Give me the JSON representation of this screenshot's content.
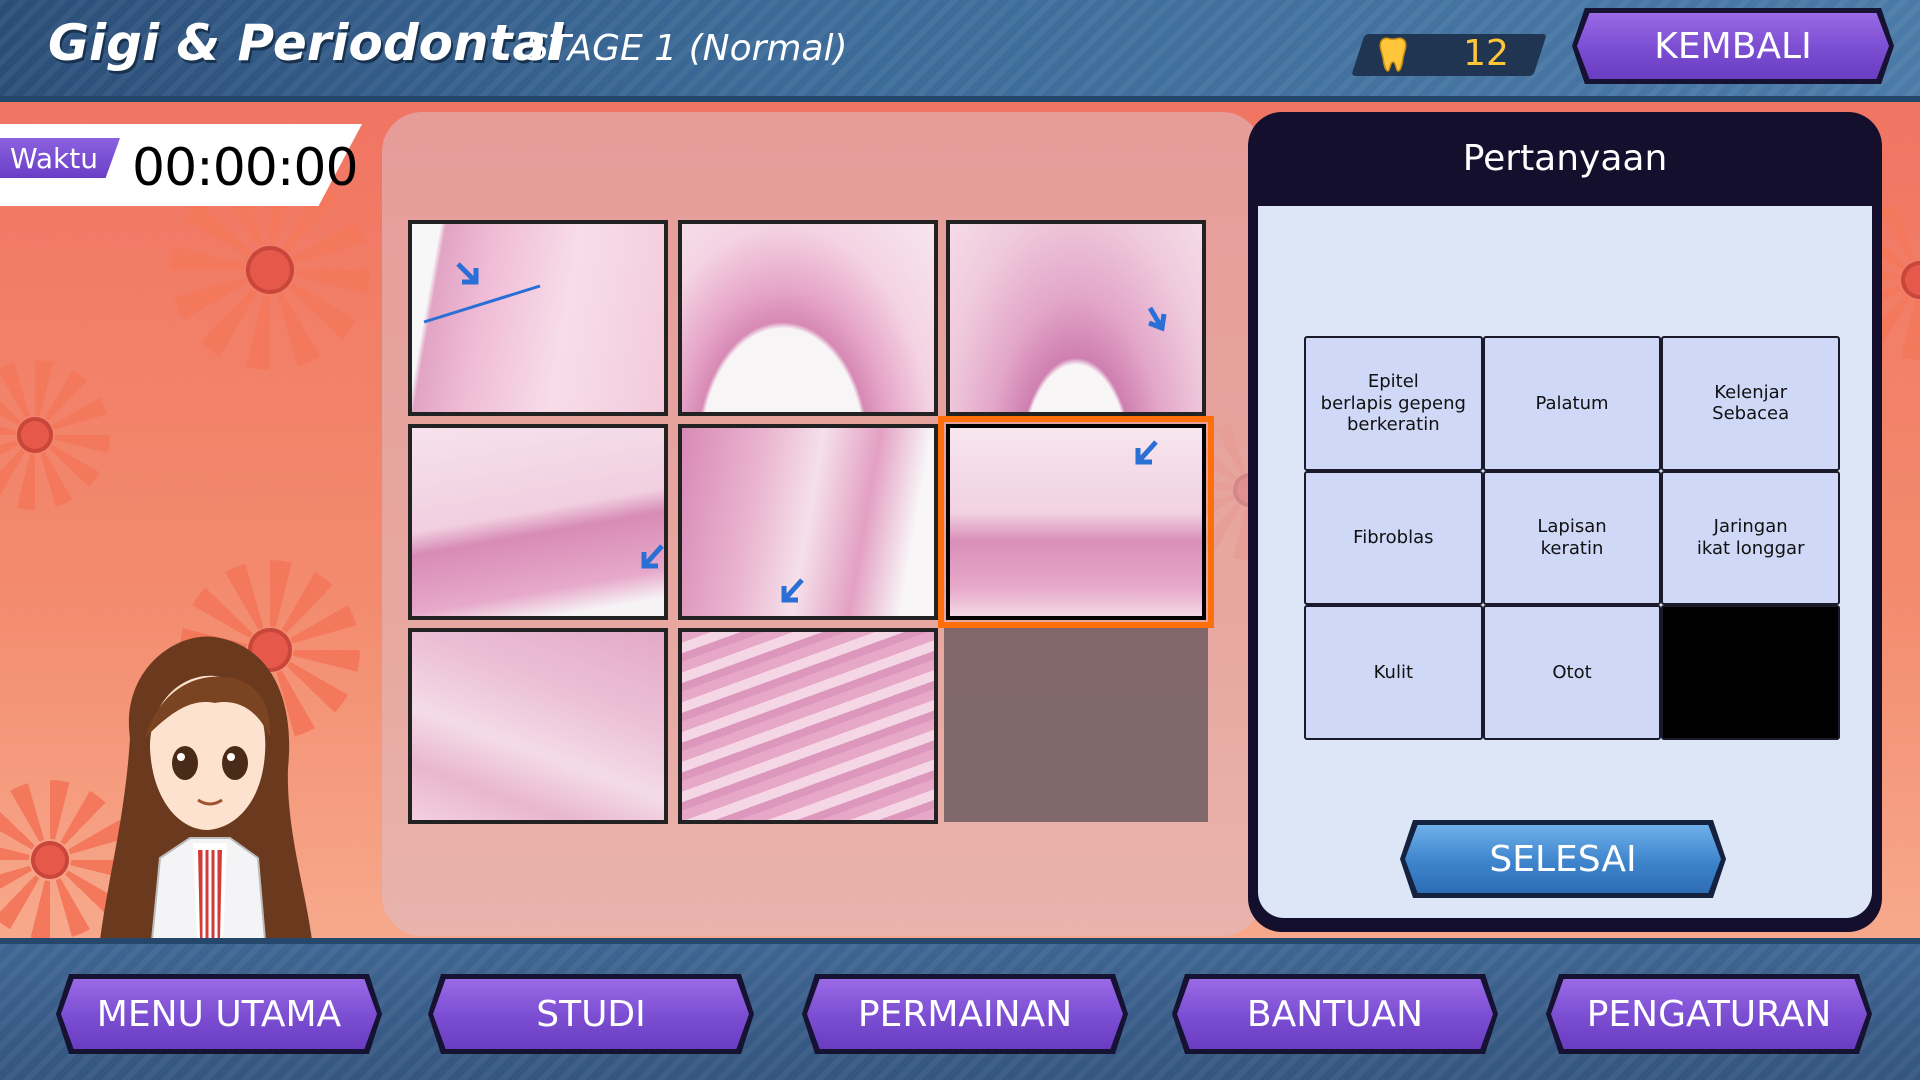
{
  "header": {
    "title": "Gigi & Periodontal",
    "stage": "STAGE 1 (Normal)",
    "score": "12",
    "back_label": "KEMBALI"
  },
  "timer": {
    "label": "Waktu",
    "value": "00:00:00"
  },
  "puzzle": {
    "tiles": [
      {
        "id": 1,
        "state": "filled"
      },
      {
        "id": 2,
        "state": "filled"
      },
      {
        "id": 3,
        "state": "filled"
      },
      {
        "id": 4,
        "state": "filled"
      },
      {
        "id": 5,
        "state": "filled"
      },
      {
        "id": 6,
        "state": "selected"
      },
      {
        "id": 7,
        "state": "filled"
      },
      {
        "id": 8,
        "state": "filled"
      },
      {
        "id": 9,
        "state": "empty"
      }
    ]
  },
  "question_panel": {
    "title": "Pertanyaan",
    "answers": [
      "Epitel\nberlapis gepeng\nberkeratin",
      "Palatum",
      "Kelenjar\nSebacea",
      "Fibroblas",
      "Lapisan\nkeratin",
      "Jaringan\nikat longgar",
      "Kulit",
      "Otot",
      ""
    ],
    "submit_label": "SELESAI"
  },
  "nav": {
    "main_menu": "MENU UTAMA",
    "study": "STUDI",
    "game": "PERMAINAN",
    "help": "BANTUAN",
    "settings": "PENGATURAN"
  },
  "colors": {
    "accent_purple": "#7d4fd3",
    "accent_blue": "#3d84cc",
    "score_gold": "#ffc63a",
    "selection_orange": "#ff6f0a",
    "topbar": "#3b6a98"
  }
}
